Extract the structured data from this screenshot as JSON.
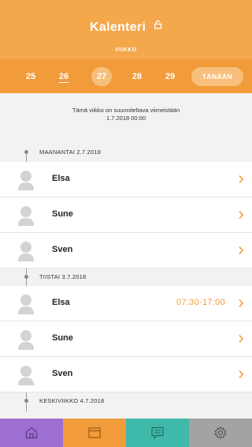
{
  "header": {
    "title": "Kalenteri",
    "week_label": "VIIKKO",
    "lock_icon": "lock-icon"
  },
  "days": [
    {
      "label": "25"
    },
    {
      "label": "26"
    },
    {
      "label": "27"
    },
    {
      "label": "28"
    },
    {
      "label": "29"
    }
  ],
  "today_button": "TÄNÄÄN",
  "notice": {
    "line1": "Tämä viikko on suunniteltava viimeistään",
    "line2": "1.7.2018 00:00"
  },
  "sections": [
    {
      "label": "MAANANTAI 2.7.2018",
      "rows": [
        {
          "name": "Elsa",
          "time": ""
        },
        {
          "name": "Sune",
          "time": ""
        },
        {
          "name": "Sven",
          "time": ""
        }
      ]
    },
    {
      "label": "TIISTAI 3.7.2018",
      "rows": [
        {
          "name": "Elsa",
          "time": "07:30-17:00"
        },
        {
          "name": "Sune",
          "time": ""
        },
        {
          "name": "Sven",
          "time": ""
        }
      ]
    },
    {
      "label": "KESKIVIIKKO 4.7.2018",
      "rows": []
    }
  ],
  "tabbar": {
    "tabs": [
      {
        "icon": "home-icon",
        "color": "#9c6fd0"
      },
      {
        "icon": "calendar-icon",
        "color": "#f29b3a"
      },
      {
        "icon": "chat-icon",
        "color": "#3fb9a9"
      },
      {
        "icon": "settings-icon",
        "color": "#a3a3a3"
      }
    ]
  },
  "colors": {
    "header": "#f5a74c",
    "day_strip": "#f29b3a",
    "accent": "#f29b3a"
  }
}
